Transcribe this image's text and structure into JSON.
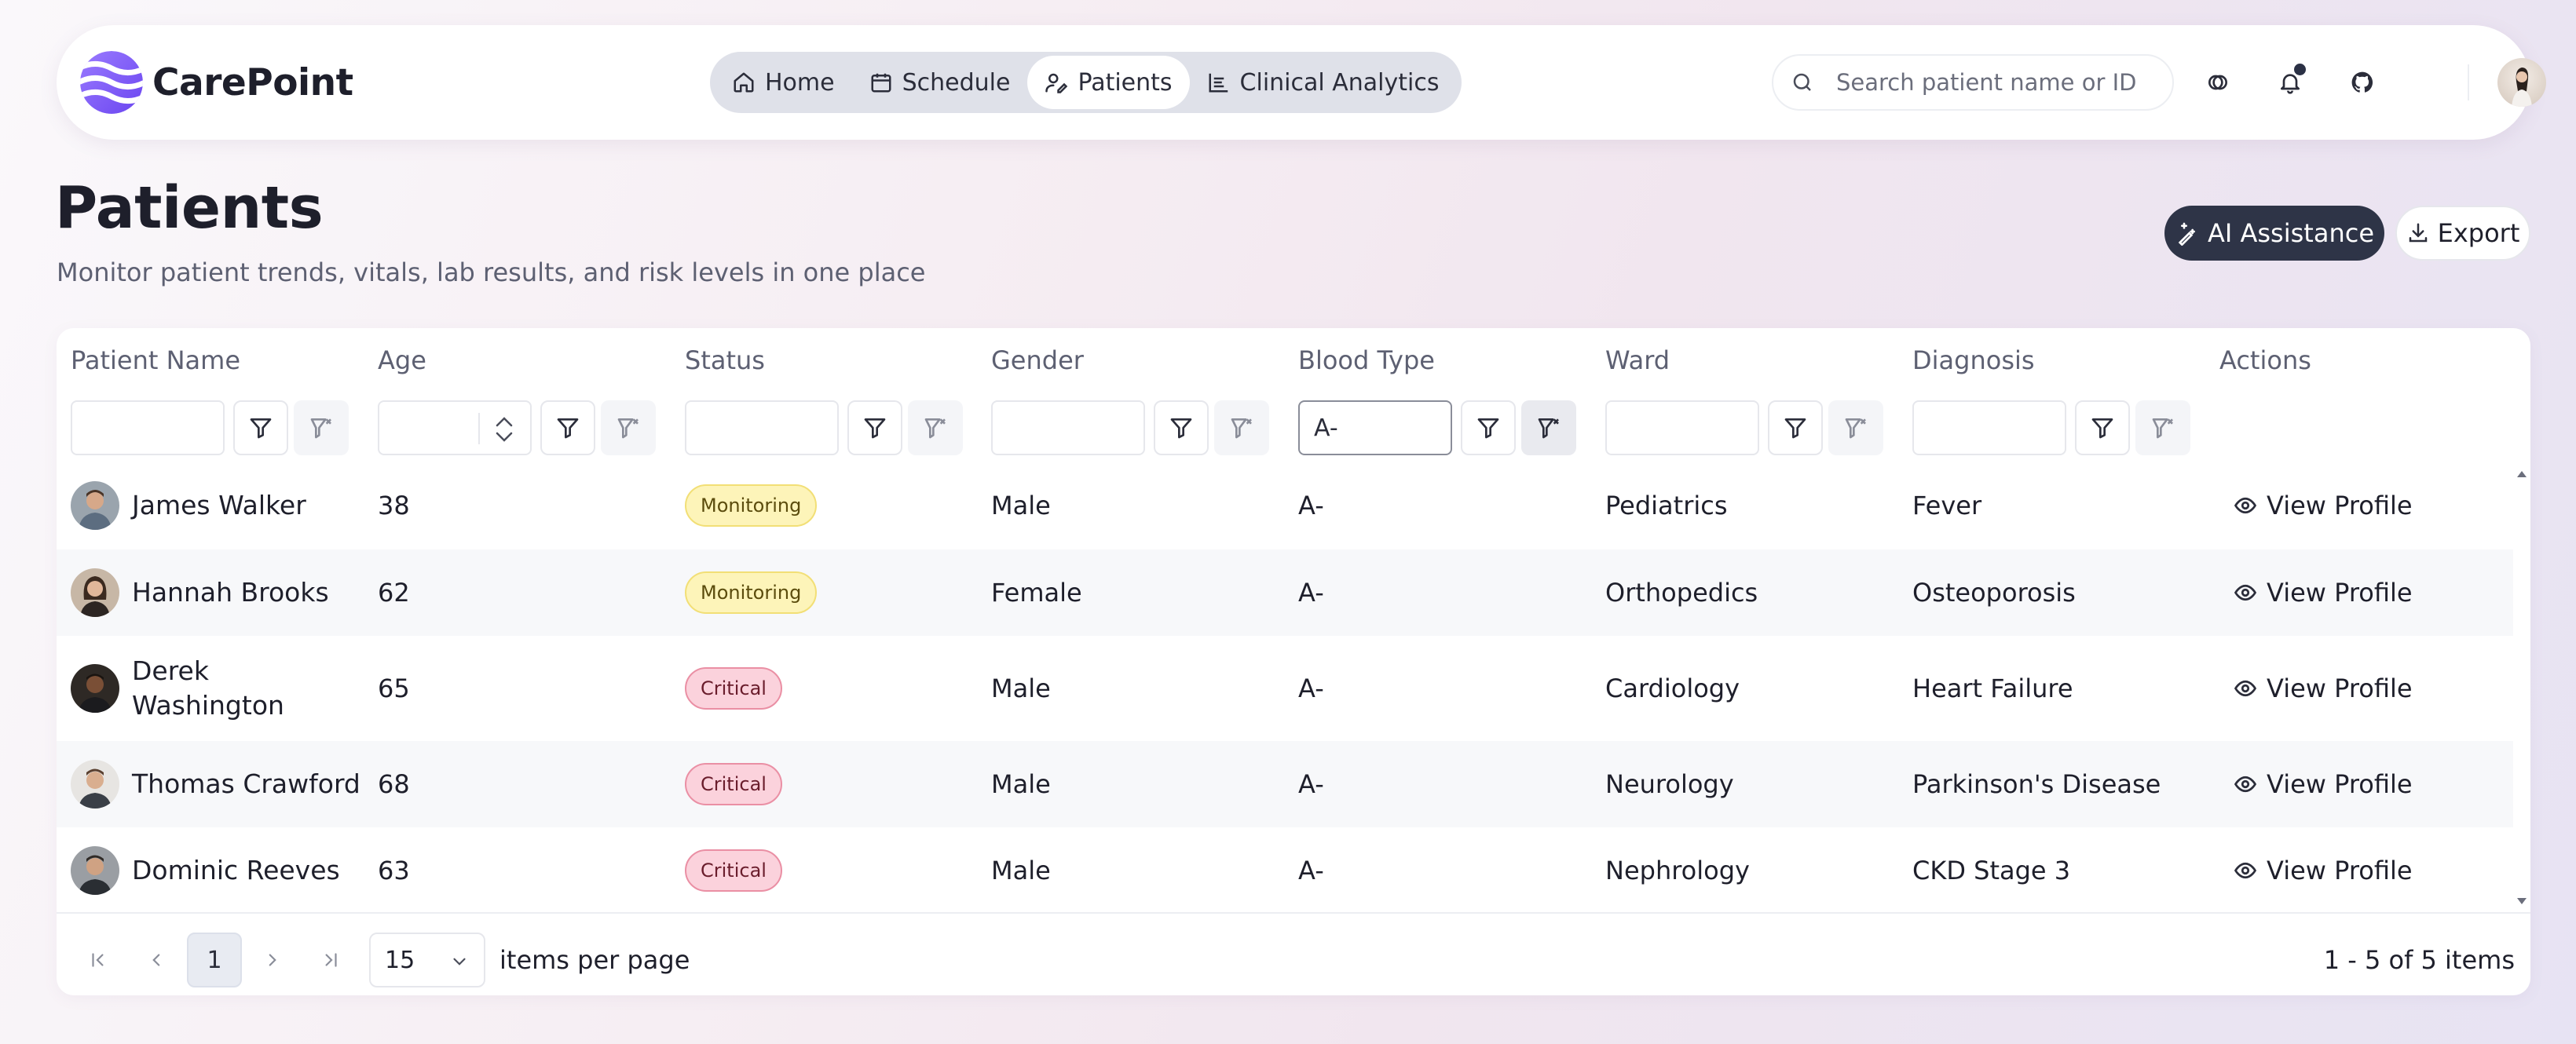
{
  "brand": {
    "name": "CarePoint",
    "accent": "#7b5cf5"
  },
  "nav": {
    "items": [
      {
        "label": "Home",
        "icon": "home-icon"
      },
      {
        "label": "Schedule",
        "icon": "calendar-icon"
      },
      {
        "label": "Patients",
        "icon": "patients-icon",
        "active": true
      },
      {
        "label": "Clinical Analytics",
        "icon": "analytics-icon"
      }
    ]
  },
  "search": {
    "placeholder": "Search patient name or ID",
    "value": ""
  },
  "header_icons": [
    "theme-icon",
    "bell-icon",
    "github-icon",
    "user-avatar"
  ],
  "page": {
    "title": "Patients",
    "subtitle": "Monitor patient trends, vitals, lab results, and risk levels in one place"
  },
  "actions": {
    "ai_label": "AI Assistance",
    "export_label": "Export"
  },
  "grid": {
    "columns": [
      "Patient Name",
      "Age",
      "Status",
      "Gender",
      "Blood Type",
      "Ward",
      "Diagnosis",
      "Actions"
    ],
    "filters": {
      "patient": "",
      "age": "",
      "status": "",
      "gender": "",
      "blood_type": "A-",
      "ward": "",
      "diagnosis": ""
    },
    "rows": [
      {
        "name": "James Walker",
        "age": "38",
        "status": "Monitoring",
        "gender": "Male",
        "blood": "A-",
        "ward": "Pediatrics",
        "diagnosis": "Fever",
        "action": "View Profile"
      },
      {
        "name": "Hannah Brooks",
        "age": "62",
        "status": "Monitoring",
        "gender": "Female",
        "blood": "A-",
        "ward": "Orthopedics",
        "diagnosis": "Osteoporosis",
        "action": "View Profile"
      },
      {
        "name": "Derek Washington",
        "age": "65",
        "status": "Critical",
        "gender": "Male",
        "blood": "A-",
        "ward": "Cardiology",
        "diagnosis": "Heart Failure",
        "action": "View Profile"
      },
      {
        "name": "Thomas Crawford",
        "age": "68",
        "status": "Critical",
        "gender": "Male",
        "blood": "A-",
        "ward": "Neurology",
        "diagnosis": "Parkinson's Disease",
        "action": "View Profile"
      },
      {
        "name": "Dominic Reeves",
        "age": "63",
        "status": "Critical",
        "gender": "Male",
        "blood": "A-",
        "ward": "Nephrology",
        "diagnosis": "CKD Stage 3",
        "action": "View Profile"
      }
    ]
  },
  "pager": {
    "current_page": "1",
    "page_size": "15",
    "items_per_page_label": "items per page",
    "summary": "1 - 5 of 5 items"
  },
  "colors": {
    "monitoring_bg": "#fdf4b9",
    "critical_bg": "#fbd2dc",
    "dark_button": "#2e3447"
  }
}
